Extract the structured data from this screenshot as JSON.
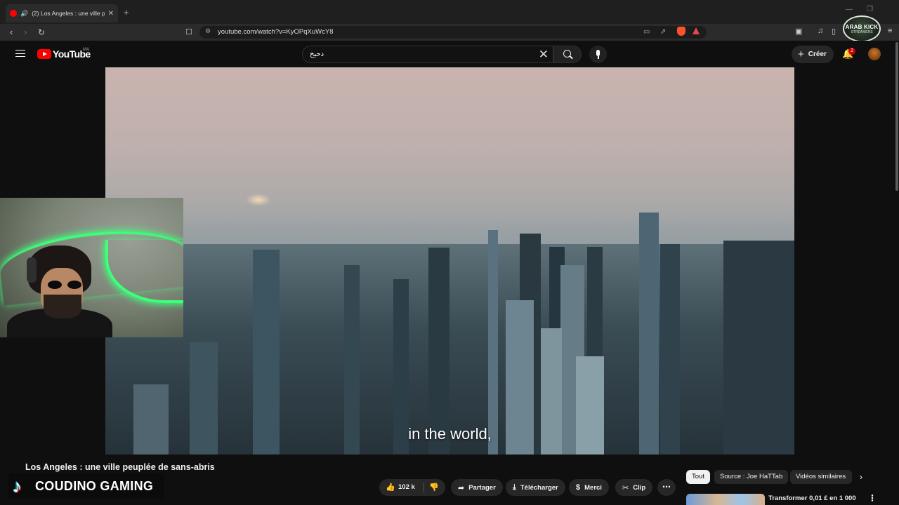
{
  "browser": {
    "tab_title": "(2) Los Angeles : une ville pe",
    "url": "youtube.com/watch?v=KyOPqXuWcY8"
  },
  "overlay_badge": {
    "line1": "ARAB KICK",
    "line2": "STREAMERS"
  },
  "youtube": {
    "logo_text": "YouTube",
    "country_code": "MA",
    "search_query": "دحيح",
    "create_label": "Créer",
    "notification_count": "2"
  },
  "player": {
    "subtitle": "in the world,"
  },
  "video": {
    "title": "Los Angeles : une ville peuplée de sans-abris",
    "likes": "102 k",
    "actions": {
      "share": "Partager",
      "download": "Télécharger",
      "thanks": "Merci",
      "clip": "Clip"
    }
  },
  "streamer_overlay": {
    "name": "COUDINO GAMING"
  },
  "chips": [
    "Tout",
    "Source : Joe HaTTab",
    "Vidéos similaires"
  ],
  "recommendation": {
    "title": "Transformer 0,01 £ en 1 000"
  },
  "colors": {
    "youtube_red": "#ff0000",
    "background": "#0f0f0f",
    "neon_green": "#3dff7a"
  }
}
